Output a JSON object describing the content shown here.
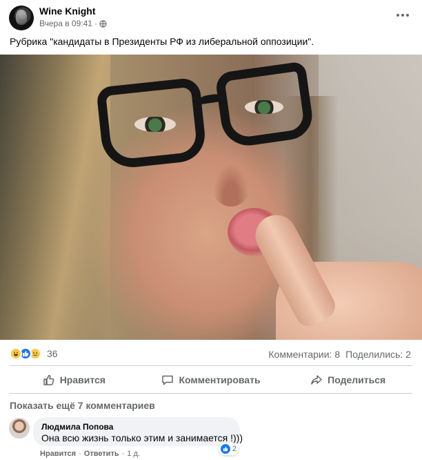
{
  "post": {
    "author": "Wine Knight",
    "time": "Вчера в 09:41",
    "meta_separator": "·",
    "privacy_icon": "globe-icon",
    "text": "Рубрика \"кандидаты в Президенты РФ из либеральной оппозиции\"."
  },
  "stats": {
    "reaction_icons": [
      "haha-icon",
      "like-icon",
      "sad-icon"
    ],
    "reactions_count": "36",
    "comments_label": "Комментарии: 8",
    "shares_label": "Поделились: 2"
  },
  "actions": {
    "like_label": "Нравится",
    "comment_label": "Комментировать",
    "share_label": "Поделиться"
  },
  "comments": {
    "more_label": "Показать ещё 7 комментариев",
    "items": [
      {
        "author": "Людмила Попова",
        "text": "Она всю жизнь только этим и занимается !)))",
        "like_action": "Нравится",
        "reply_action": "Ответить",
        "separator": "·",
        "age": "1 д.",
        "like_count": "2"
      }
    ]
  },
  "colors": {
    "accent": "#1877f2",
    "secondary_text": "#65676b",
    "bubble_bg": "#f0f2f5",
    "divider": "#ced0d4"
  }
}
